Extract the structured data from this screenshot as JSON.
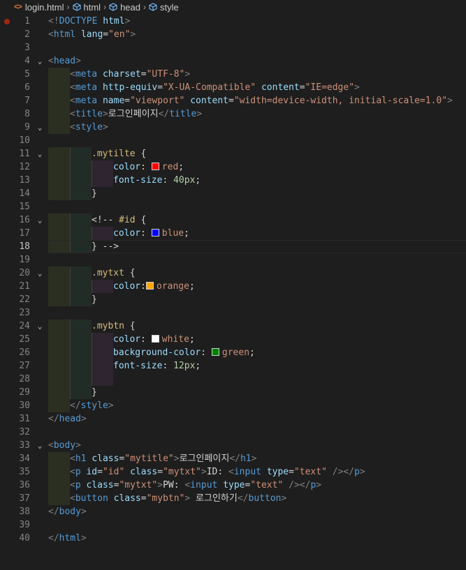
{
  "breadcrumb": {
    "file": "login.html",
    "path": [
      "html",
      "head",
      "style"
    ]
  },
  "editor": {
    "active_line": 18,
    "breakpoint_line": 1,
    "lines": [
      {
        "n": 1,
        "ind": [
          0,
          0,
          0
        ],
        "fold": "",
        "tokens": [
          [
            "ang",
            "<!"
          ],
          [
            "tag",
            "DOCTYPE "
          ],
          [
            "attr",
            "html"
          ],
          [
            "ang",
            ">"
          ]
        ]
      },
      {
        "n": 2,
        "ind": [
          0,
          0,
          0
        ],
        "fold": "",
        "tokens": [
          [
            "ang",
            "<"
          ],
          [
            "tag",
            "html "
          ],
          [
            "attr",
            "lang"
          ],
          [
            "txt",
            "="
          ],
          [
            "str",
            "\"en\""
          ],
          [
            "ang",
            ">"
          ]
        ]
      },
      {
        "n": 3,
        "ind": [
          0,
          0,
          0
        ],
        "fold": "",
        "tokens": []
      },
      {
        "n": 4,
        "ind": [
          0,
          0,
          0
        ],
        "fold": "v",
        "tokens": [
          [
            "ang",
            "<"
          ],
          [
            "tag",
            "head"
          ],
          [
            "ang",
            ">"
          ]
        ]
      },
      {
        "n": 5,
        "ind": [
          1,
          0,
          0
        ],
        "fold": "",
        "tokens": [
          [
            "ang",
            "<"
          ],
          [
            "tag",
            "meta "
          ],
          [
            "attr",
            "charset"
          ],
          [
            "txt",
            "="
          ],
          [
            "str",
            "\"UTF-8\""
          ],
          [
            "ang",
            ">"
          ]
        ]
      },
      {
        "n": 6,
        "ind": [
          1,
          0,
          0
        ],
        "fold": "",
        "tokens": [
          [
            "ang",
            "<"
          ],
          [
            "tag",
            "meta "
          ],
          [
            "attr",
            "http-equiv"
          ],
          [
            "txt",
            "="
          ],
          [
            "str",
            "\"X-UA-Compatible\" "
          ],
          [
            "attr",
            "content"
          ],
          [
            "txt",
            "="
          ],
          [
            "str",
            "\"IE=edge\""
          ],
          [
            "ang",
            ">"
          ]
        ]
      },
      {
        "n": 7,
        "ind": [
          1,
          0,
          0
        ],
        "fold": "",
        "tokens": [
          [
            "ang",
            "<"
          ],
          [
            "tag",
            "meta "
          ],
          [
            "attr",
            "name"
          ],
          [
            "txt",
            "="
          ],
          [
            "str",
            "\"viewport\" "
          ],
          [
            "attr",
            "content"
          ],
          [
            "txt",
            "="
          ],
          [
            "str",
            "\"width=device-width, initial-scale=1.0\""
          ],
          [
            "ang",
            ">"
          ]
        ]
      },
      {
        "n": 8,
        "ind": [
          1,
          0,
          0
        ],
        "fold": "",
        "tokens": [
          [
            "ang",
            "<"
          ],
          [
            "tag",
            "title"
          ],
          [
            "ang",
            ">"
          ],
          [
            "txt",
            "로그인페이지"
          ],
          [
            "ang",
            "</"
          ],
          [
            "tag",
            "title"
          ],
          [
            "ang",
            ">"
          ]
        ]
      },
      {
        "n": 9,
        "ind": [
          1,
          0,
          0
        ],
        "fold": "v",
        "tokens": [
          [
            "ang",
            "<"
          ],
          [
            "tag",
            "style"
          ],
          [
            "ang",
            ">"
          ]
        ]
      },
      {
        "n": 10,
        "ind": [
          0,
          0,
          0
        ],
        "fold": "",
        "tokens": []
      },
      {
        "n": 11,
        "ind": [
          1,
          1,
          0
        ],
        "fold": "v",
        "tokens": [
          [
            "sel",
            ".mytilte "
          ],
          [
            "txt",
            "{"
          ]
        ]
      },
      {
        "n": 12,
        "ind": [
          1,
          1,
          1
        ],
        "fold": "",
        "tokens": [
          [
            "prop",
            "color"
          ],
          [
            "txt",
            ": "
          ],
          [
            "sw",
            "#ff0000"
          ],
          [
            "val",
            "red"
          ],
          [
            "txt",
            ";"
          ]
        ]
      },
      {
        "n": 13,
        "ind": [
          1,
          1,
          1
        ],
        "fold": "",
        "tokens": [
          [
            "prop",
            "font-size"
          ],
          [
            "txt",
            ": "
          ],
          [
            "num",
            "40px"
          ],
          [
            "txt",
            ";"
          ]
        ]
      },
      {
        "n": 14,
        "ind": [
          1,
          1,
          0
        ],
        "fold": "",
        "tokens": [
          [
            "txt",
            "}"
          ]
        ]
      },
      {
        "n": 15,
        "ind": [
          0,
          0,
          0
        ],
        "fold": "",
        "tokens": []
      },
      {
        "n": 16,
        "ind": [
          1,
          1,
          0
        ],
        "fold": "v",
        "tokens": [
          [
            "txt",
            "<!-- "
          ],
          [
            "sel",
            "#id "
          ],
          [
            "txt",
            "{"
          ]
        ]
      },
      {
        "n": 17,
        "ind": [
          1,
          1,
          1
        ],
        "fold": "",
        "tokens": [
          [
            "prop",
            "color"
          ],
          [
            "txt",
            ": "
          ],
          [
            "sw",
            "#0000ff"
          ],
          [
            "val",
            "blue"
          ],
          [
            "txt",
            ";"
          ]
        ]
      },
      {
        "n": 18,
        "ind": [
          1,
          1,
          0
        ],
        "fold": "",
        "tokens": [
          [
            "txt",
            "} -->"
          ]
        ]
      },
      {
        "n": 19,
        "ind": [
          0,
          0,
          0
        ],
        "fold": "",
        "tokens": []
      },
      {
        "n": 20,
        "ind": [
          1,
          1,
          0
        ],
        "fold": "v",
        "tokens": [
          [
            "sel",
            ".mytxt "
          ],
          [
            "txt",
            "{"
          ]
        ]
      },
      {
        "n": 21,
        "ind": [
          1,
          1,
          1
        ],
        "fold": "",
        "tokens": [
          [
            "prop",
            "color"
          ],
          [
            "txt",
            ":"
          ],
          [
            "sw",
            "#ffa500"
          ],
          [
            "val",
            "orange"
          ],
          [
            "txt",
            ";"
          ]
        ]
      },
      {
        "n": 22,
        "ind": [
          1,
          1,
          0
        ],
        "fold": "",
        "tokens": [
          [
            "txt",
            "}"
          ]
        ]
      },
      {
        "n": 23,
        "ind": [
          0,
          0,
          0
        ],
        "fold": "",
        "tokens": []
      },
      {
        "n": 24,
        "ind": [
          1,
          1,
          0
        ],
        "fold": "v",
        "tokens": [
          [
            "sel",
            ".mybtn "
          ],
          [
            "txt",
            "{"
          ]
        ]
      },
      {
        "n": 25,
        "ind": [
          1,
          1,
          1
        ],
        "fold": "",
        "tokens": [
          [
            "prop",
            "color"
          ],
          [
            "txt",
            ": "
          ],
          [
            "sw",
            "#ffffff"
          ],
          [
            "val",
            "white"
          ],
          [
            "txt",
            ";"
          ]
        ]
      },
      {
        "n": 26,
        "ind": [
          1,
          1,
          1
        ],
        "fold": "",
        "tokens": [
          [
            "prop",
            "background-color"
          ],
          [
            "txt",
            ": "
          ],
          [
            "sw",
            "#008000"
          ],
          [
            "val",
            "green"
          ],
          [
            "txt",
            ";"
          ]
        ]
      },
      {
        "n": 27,
        "ind": [
          1,
          1,
          1
        ],
        "fold": "",
        "tokens": [
          [
            "prop",
            "font-size"
          ],
          [
            "txt",
            ": "
          ],
          [
            "num",
            "12px"
          ],
          [
            "txt",
            ";"
          ]
        ]
      },
      {
        "n": 28,
        "ind": [
          1,
          1,
          1
        ],
        "fold": "",
        "tokens": []
      },
      {
        "n": 29,
        "ind": [
          1,
          1,
          0
        ],
        "fold": "",
        "tokens": [
          [
            "txt",
            "}"
          ]
        ]
      },
      {
        "n": 30,
        "ind": [
          1,
          0,
          0
        ],
        "fold": "",
        "tokens": [
          [
            "ang",
            "</"
          ],
          [
            "tag",
            "style"
          ],
          [
            "ang",
            ">"
          ]
        ]
      },
      {
        "n": 31,
        "ind": [
          0,
          0,
          0
        ],
        "fold": "",
        "tokens": [
          [
            "ang",
            "</"
          ],
          [
            "tag",
            "head"
          ],
          [
            "ang",
            ">"
          ]
        ]
      },
      {
        "n": 32,
        "ind": [
          0,
          0,
          0
        ],
        "fold": "",
        "tokens": []
      },
      {
        "n": 33,
        "ind": [
          0,
          0,
          0
        ],
        "fold": "v",
        "tokens": [
          [
            "ang",
            "<"
          ],
          [
            "tag",
            "body"
          ],
          [
            "ang",
            ">"
          ]
        ]
      },
      {
        "n": 34,
        "ind": [
          1,
          0,
          0
        ],
        "fold": "",
        "tokens": [
          [
            "ang",
            "<"
          ],
          [
            "tag",
            "h1 "
          ],
          [
            "attr",
            "class"
          ],
          [
            "txt",
            "="
          ],
          [
            "str",
            "\"mytitle\""
          ],
          [
            "ang",
            ">"
          ],
          [
            "txt",
            "로그인페이지"
          ],
          [
            "ang",
            "</"
          ],
          [
            "tag",
            "h1"
          ],
          [
            "ang",
            ">"
          ]
        ]
      },
      {
        "n": 35,
        "ind": [
          1,
          0,
          0
        ],
        "fold": "",
        "tokens": [
          [
            "ang",
            "<"
          ],
          [
            "tag",
            "p "
          ],
          [
            "attr",
            "id"
          ],
          [
            "txt",
            "="
          ],
          [
            "str",
            "\"id\" "
          ],
          [
            "attr",
            "class"
          ],
          [
            "txt",
            "="
          ],
          [
            "str",
            "\"mytxt\""
          ],
          [
            "ang",
            ">"
          ],
          [
            "txt",
            "ID: "
          ],
          [
            "ang",
            "<"
          ],
          [
            "tag",
            "input "
          ],
          [
            "attr",
            "type"
          ],
          [
            "txt",
            "="
          ],
          [
            "str",
            "\"text\" "
          ],
          [
            "ang",
            "/></"
          ],
          [
            "tag",
            "p"
          ],
          [
            "ang",
            ">"
          ]
        ]
      },
      {
        "n": 36,
        "ind": [
          1,
          0,
          0
        ],
        "fold": "",
        "tokens": [
          [
            "ang",
            "<"
          ],
          [
            "tag",
            "p "
          ],
          [
            "attr",
            "class"
          ],
          [
            "txt",
            "="
          ],
          [
            "str",
            "\"mytxt\""
          ],
          [
            "ang",
            ">"
          ],
          [
            "txt",
            "PW: "
          ],
          [
            "ang",
            "<"
          ],
          [
            "tag",
            "input "
          ],
          [
            "attr",
            "type"
          ],
          [
            "txt",
            "="
          ],
          [
            "str",
            "\"text\" "
          ],
          [
            "ang",
            "/></"
          ],
          [
            "tag",
            "p"
          ],
          [
            "ang",
            ">"
          ]
        ]
      },
      {
        "n": 37,
        "ind": [
          1,
          0,
          0
        ],
        "fold": "",
        "tokens": [
          [
            "ang",
            "<"
          ],
          [
            "tag",
            "button "
          ],
          [
            "attr",
            "class"
          ],
          [
            "txt",
            "="
          ],
          [
            "str",
            "\"mybtn\""
          ],
          [
            "ang",
            ">"
          ],
          [
            "txt",
            " 로그인하기"
          ],
          [
            "ang",
            "</"
          ],
          [
            "tag",
            "button"
          ],
          [
            "ang",
            ">"
          ]
        ]
      },
      {
        "n": 38,
        "ind": [
          0,
          0,
          0
        ],
        "fold": "",
        "tokens": [
          [
            "ang",
            "</"
          ],
          [
            "tag",
            "body"
          ],
          [
            "ang",
            ">"
          ]
        ]
      },
      {
        "n": 39,
        "ind": [
          0,
          0,
          0
        ],
        "fold": "",
        "tokens": []
      },
      {
        "n": 40,
        "ind": [
          0,
          0,
          0
        ],
        "fold": "",
        "tokens": [
          [
            "ang",
            "</"
          ],
          [
            "tag",
            "html"
          ],
          [
            "ang",
            ">"
          ]
        ]
      }
    ]
  }
}
